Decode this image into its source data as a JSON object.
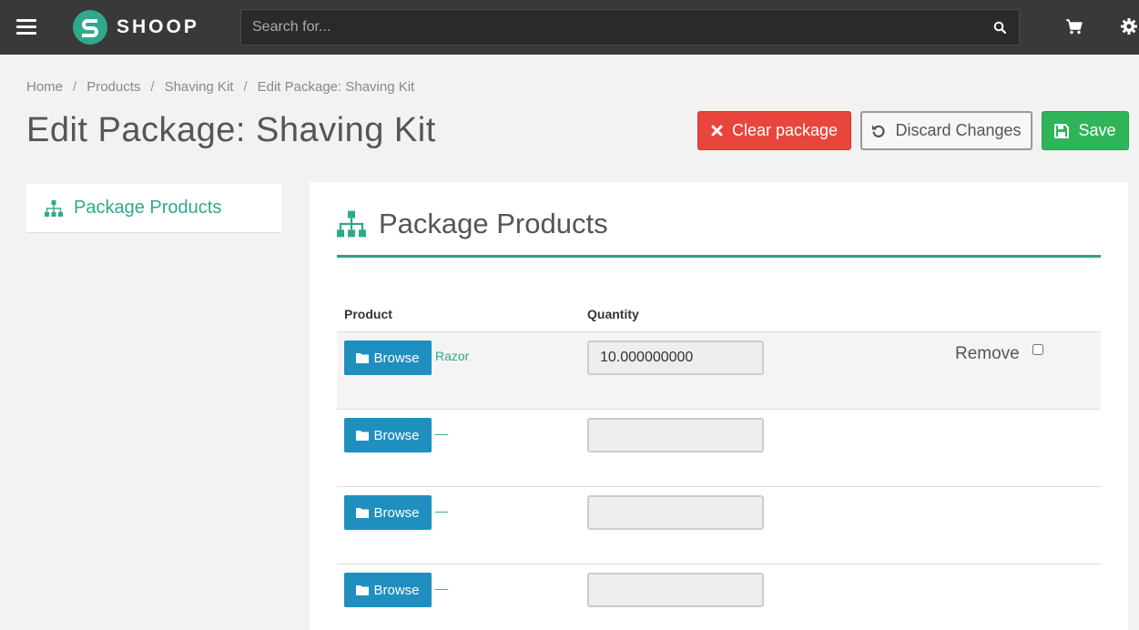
{
  "header": {
    "logo_text": "SHOOP",
    "search_placeholder": "Search for..."
  },
  "breadcrumb": [
    "Home",
    "Products",
    "Shaving Kit",
    "Edit Package: Shaving Kit"
  ],
  "page_title": "Edit Package: Shaving Kit",
  "actions": {
    "clear_label": "Clear package",
    "discard_label": "Discard Changes",
    "save_label": "Save"
  },
  "sidebar": {
    "items": [
      {
        "label": "Package Products"
      }
    ]
  },
  "panel": {
    "title": "Package Products",
    "columns": {
      "product": "Product",
      "quantity": "Quantity"
    },
    "rows": [
      {
        "browse_label": "Browse",
        "product": "Razor",
        "quantity": "10.000000000",
        "remove_label": "Remove"
      },
      {
        "browse_label": "Browse",
        "product": "—",
        "quantity": ""
      },
      {
        "browse_label": "Browse",
        "product": "—",
        "quantity": ""
      },
      {
        "browse_label": "Browse",
        "product": "—",
        "quantity": ""
      }
    ]
  },
  "colors": {
    "topbar": "#393939",
    "brand": "#2fa98c",
    "danger": "#e8453c",
    "success": "#30b459",
    "primary": "#1f8fbf"
  },
  "icons": [
    "menu-icon",
    "shoop-logo-icon",
    "search-icon",
    "cart-icon",
    "gear-icon",
    "close-icon",
    "undo-icon",
    "floppy-icon",
    "sitemap-icon",
    "folder-icon"
  ]
}
